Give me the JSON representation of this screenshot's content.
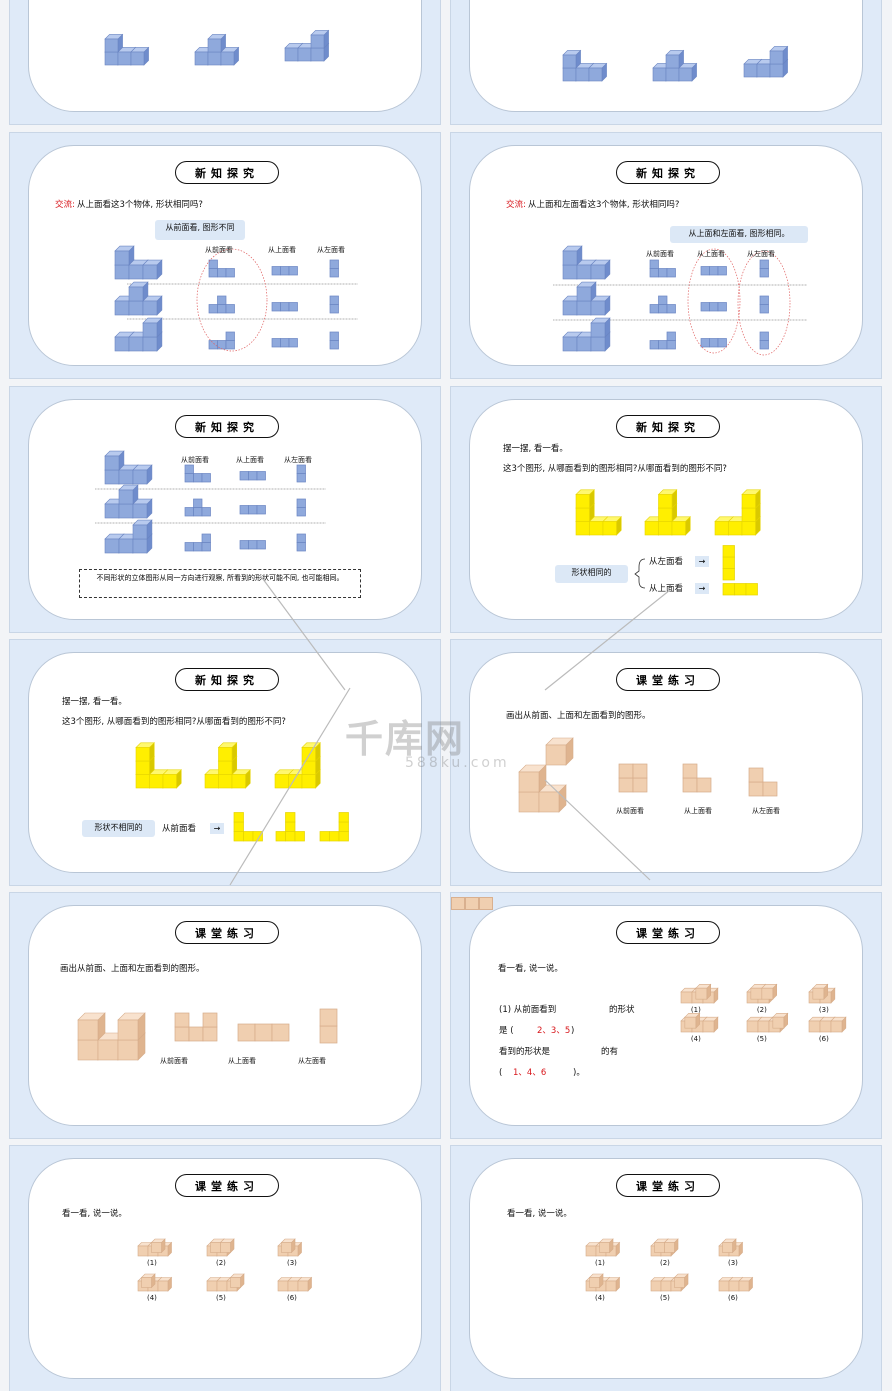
{
  "colors": {
    "blue": "#8fa9dc",
    "yellow": "#ffef00",
    "tan": "#f0cfb0",
    "accent_red": "#d8161b",
    "bubble": "#dce8f6"
  },
  "watermark": {
    "logo": "千库网",
    "url": "588ku.com"
  },
  "slides": [
    {
      "type": "cubes-partial"
    },
    {
      "type": "cubes-partial"
    },
    {
      "title": "新知探究",
      "prompt_label": "交流:",
      "prompt": "从上面看这3个物体, 形状相同吗?",
      "bubble": "从前面看, 图形不同",
      "columns": [
        "从前面看",
        "从上面看",
        "从左面看"
      ]
    },
    {
      "title": "新知探究",
      "prompt_label": "交流:",
      "prompt": "从上面和左面看这3个物体, 形状相同吗?",
      "bubble": "从上面和左面看, 图形相同。",
      "columns": [
        "从前面看",
        "从上面看",
        "从左面看"
      ]
    },
    {
      "title": "新知探究",
      "columns": [
        "从前面看",
        "从上面看",
        "从左面看"
      ],
      "conclusion": "不同形状的立体图形从同一方向进行观察, 所看到的形状可能不同, 也可能相同。"
    },
    {
      "title": "新知探究",
      "line1": "摆一摆, 看一看。",
      "line2": "这3个图形, 从哪面看到的图形相同?从哪面看到的图形不同?",
      "bubble": "形状相同的",
      "views": [
        "从左面看",
        "从上面看"
      ],
      "arrow": "→"
    },
    {
      "title": "新知探究",
      "line1": "摆一摆, 看一看。",
      "line2": "这3个图形, 从哪面看到的图形相同?从哪面看到的图形不同?",
      "bubble": "形状不相同的",
      "view": "从前面看",
      "arrow": "→"
    },
    {
      "title": "课堂练习",
      "prompt": "画出从前面、上面和左面看到的图形。",
      "columns": [
        "从前面看",
        "从上面看",
        "从左面看"
      ]
    },
    {
      "title": "课堂练习",
      "prompt": "画出从前面、上面和左面看到的图形。",
      "columns": [
        "从前面看",
        "从上面看",
        "从左面看"
      ]
    },
    {
      "title": "课堂练习",
      "prompt": "看一看, 说一说。",
      "q1a": "(1) 从前面看到",
      "q1b": "的形状",
      "q2a": "是 (",
      "answer1": "2、3、5",
      "q2b": ")",
      "q3a": "看到的形状是",
      "q3b": "的有",
      "q4a": "(",
      "answer2": "1、4、6",
      "q4b": ")。",
      "labels": [
        "(1)",
        "(2)",
        "(3)",
        "(4)",
        "(5)",
        "(6)"
      ]
    },
    {
      "title": "课堂练习",
      "prompt": "看一看, 说一说。",
      "labels": [
        "(1)",
        "(2)",
        "(3)",
        "(4)",
        "(5)",
        "(6)"
      ]
    },
    {
      "title": "课堂练习",
      "prompt": "看一看, 说一说。",
      "labels": [
        "(1)",
        "(2)",
        "(3)",
        "(4)",
        "(5)",
        "(6)"
      ]
    }
  ]
}
